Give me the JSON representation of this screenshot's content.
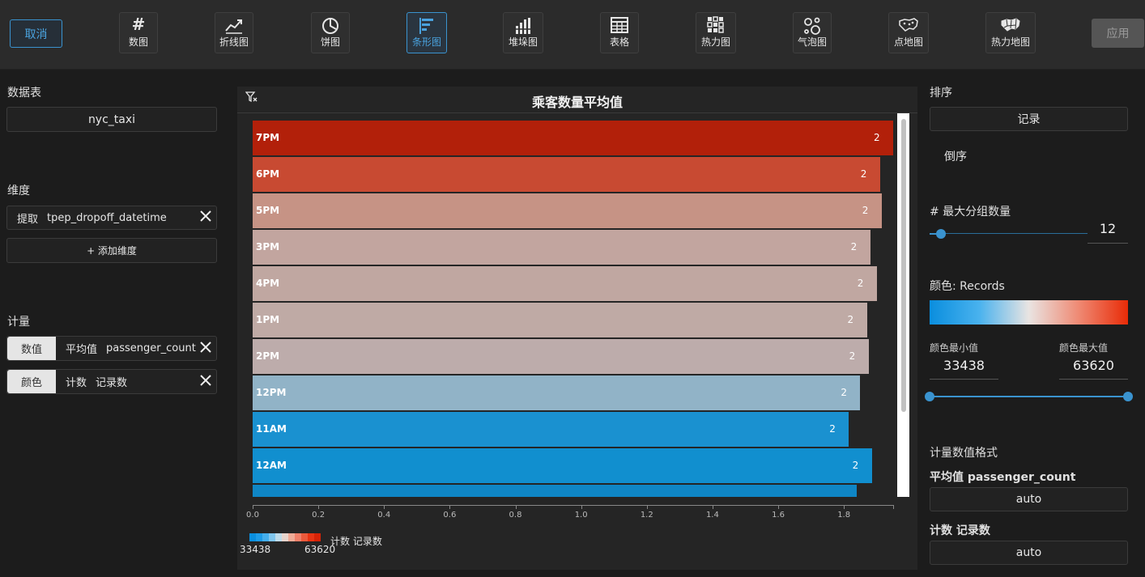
{
  "toolbar": {
    "cancel_label": "取消",
    "apply_label": "应用",
    "chart_types": [
      {
        "key": "number",
        "label": "数图",
        "icon": "hash-icon"
      },
      {
        "key": "line",
        "label": "折线图",
        "icon": "line-chart-icon"
      },
      {
        "key": "pie",
        "label": "饼图",
        "icon": "pie-chart-icon"
      },
      {
        "key": "bar",
        "label": "条形图",
        "icon": "bar-chart-icon",
        "active": true
      },
      {
        "key": "stacked",
        "label": "堆垛图",
        "icon": "stacked-bar-icon"
      },
      {
        "key": "table",
        "label": "表格",
        "icon": "table-icon"
      },
      {
        "key": "heat",
        "label": "热力图",
        "icon": "heatmap-icon"
      },
      {
        "key": "bubble",
        "label": "气泡图",
        "icon": "bubble-chart-icon"
      },
      {
        "key": "pointmap",
        "label": "点地图",
        "icon": "point-map-icon"
      },
      {
        "key": "heatmap_geo",
        "label": "热力地图",
        "icon": "choropleth-icon"
      }
    ]
  },
  "left": {
    "table_title": "数据表",
    "table_value": "nyc_taxi",
    "dimension_title": "维度",
    "dimension": {
      "prefix": "提取",
      "field": "tpep_dropoff_datetime"
    },
    "add_dimension": "+ 添加维度",
    "measure_title": "计量",
    "measures": [
      {
        "tag": "数值",
        "agg": "平均值",
        "field": "passenger_count"
      },
      {
        "tag": "颜色",
        "agg": "计数",
        "field": "记录数"
      }
    ]
  },
  "chart_data": {
    "type": "bar",
    "orientation": "horizontal",
    "title": "乘客数量平均值",
    "categories": [
      "7PM",
      "6PM",
      "5PM",
      "3PM",
      "4PM",
      "1PM",
      "2PM",
      "12PM",
      "11AM",
      "12AM"
    ],
    "values": [
      1.95,
      1.91,
      1.915,
      1.88,
      1.9,
      1.87,
      1.875,
      1.85,
      1.815,
      1.885
    ],
    "data_labels": [
      "2",
      "2",
      "2",
      "2",
      "2",
      "2",
      "2",
      "2",
      "2",
      "2"
    ],
    "colors": [
      "#b2200a",
      "#c84a32",
      "#c69385",
      "#c2a59f",
      "#c0a7a1",
      "#bfaaa5",
      "#bdacab",
      "#91b3c7",
      "#1a91d0",
      "#118fcf"
    ],
    "partial_bar": {
      "value": 1.84,
      "color": "#0f86c6"
    },
    "xlim": [
      0,
      1.95
    ],
    "xticks": [
      "0.0",
      "0.2",
      "0.4",
      "0.6",
      "0.8",
      "1.0",
      "1.2",
      "1.4",
      "1.6",
      "1.8"
    ],
    "legend": {
      "label": "计数 记录数",
      "min": "33438",
      "max": "63620",
      "swatches": [
        "#0a8ede",
        "#1e9be6",
        "#45aeeb",
        "#80c6ed",
        "#bfdcea",
        "#e8d4cc",
        "#f0ab97",
        "#f0806a",
        "#ec5a3c",
        "#e83414",
        "#d82307"
      ]
    }
  },
  "right": {
    "sort_title": "排序",
    "sort_value": "记录",
    "sort_order": "倒序",
    "max_groups_title": "# 最大分组数量",
    "max_groups_value": "12",
    "max_groups_fraction": 0.07,
    "color_title": "颜色: Records",
    "color_min_label": "颜色最小值",
    "color_max_label": "颜色最大值",
    "color_min_value": "33438",
    "color_max_value": "63620",
    "format_title": "计量数值格式",
    "format_items": [
      {
        "label": "平均值 passenger_count",
        "value": "auto"
      },
      {
        "label": "计数 记录数",
        "value": "auto"
      }
    ],
    "accent": "#3a93cf"
  }
}
